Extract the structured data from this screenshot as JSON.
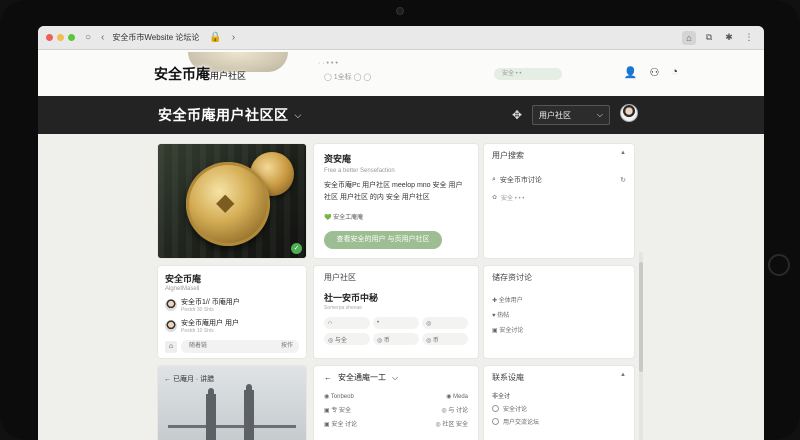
{
  "browser": {
    "tab_title": "安全币市Website 论坛论",
    "nav_back": "‹",
    "nav_forward": "›",
    "reload": "○"
  },
  "ghost": {
    "title": "安全币庵",
    "title_small": "用户社区",
    "mid_text": "· · • • •",
    "mid_text2": "◯ 1全标  ◯ ◯",
    "pill": "安全 • •"
  },
  "header": {
    "title": "安全币庵用户社区区",
    "select_value": "用户社区"
  },
  "hero": {
    "alt_label": "安全币庵"
  },
  "description": {
    "title": "资安庵",
    "subtitle": "Free a better Sensefaction",
    "line": "安全币庵Pc 用户社区 meelop mno 安全 用户社区 用户社区 的内 安全 用户社区",
    "tag_label": "安全工庵庵",
    "button": "查看安全的用户 与页用户社区"
  },
  "users": {
    "title": "用户搜索",
    "search_text": "安全币市讨论",
    "row_text": "安全 • • •"
  },
  "profile": {
    "title": "安全币庵",
    "subtitle": "AlgnetMasell",
    "rows": [
      {
        "name": "安全币1// 币庵用户",
        "meta": "Pestdr 30 Shts"
      },
      {
        "name": "安全币庵用户 用户",
        "meta": "Pestdr 10 Shts"
      }
    ],
    "input_text": "随着链",
    "input_action": "按作"
  },
  "community": {
    "title": "用户社区",
    "heading": "社一安币中秘",
    "sub": "Somerpa shenae",
    "cells": [
      "∩",
      "•",
      "◎",
      "◎  与全",
      "◎  币",
      "◎  币"
    ]
  },
  "activity": {
    "title": "储存资讨论",
    "items": [
      "✚ 全体用户",
      "♥ 热帖",
      "▣ 安全讨论"
    ]
  },
  "city": {
    "label": "←  已庵月 · 讲腊"
  },
  "security": {
    "title": "安全通庵一工",
    "rows": [
      {
        "left": "◉ Tonbeob",
        "right": "◉ Meda"
      },
      {
        "left": "▣ 专 安全",
        "right": "◎ 与 讨论"
      },
      {
        "left": "▣ 安全 讨论",
        "right": "◎ 社区 安全"
      }
    ]
  },
  "poll": {
    "title": "联系设庵",
    "question": "非全讨",
    "options": [
      "安全讨论",
      "用户交流论坛"
    ]
  }
}
